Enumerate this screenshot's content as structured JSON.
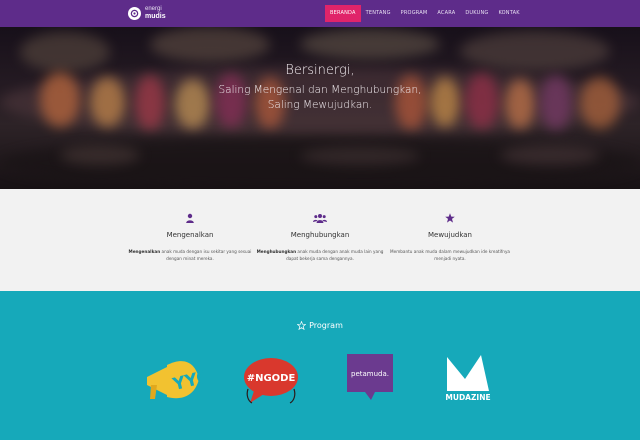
{
  "brand": {
    "top": "energi",
    "bottom": "mudis"
  },
  "nav": [
    {
      "label": "BERANDA",
      "active": true
    },
    {
      "label": "TENTANG",
      "active": false
    },
    {
      "label": "PROGRAM",
      "active": false
    },
    {
      "label": "ACARA",
      "active": false
    },
    {
      "label": "DUKUNG",
      "active": false
    },
    {
      "label": "KONTAK",
      "active": false
    }
  ],
  "hero": {
    "title": "Bersinergi,",
    "line1": "Saling Mengenal dan Menghubungkan,",
    "line2": "Saling Mewujudkan."
  },
  "features": [
    {
      "icon": "user-icon",
      "title": "Mengenalkan",
      "bold": "Mengenalkan",
      "desc": " anak muda dengan isu sekitar yang sesuai dengan minat mereka."
    },
    {
      "icon": "users-icon",
      "title": "Menghubungkan",
      "bold": "Menghubungkan",
      "desc": " anak muda dengan anak muda lain yang dapat bekerja sama dengannya."
    },
    {
      "icon": "star-icon",
      "title": "Mewujudkan",
      "bold": "",
      "desc": "Membantu anak muda dalam mewujudkan ide kreatifnya menjadi nyata."
    }
  ],
  "program": {
    "heading": "Program",
    "logos": [
      {
        "name": "yyc-logo",
        "text": "YYC"
      },
      {
        "name": "ngode-logo",
        "text": "#NGODE"
      },
      {
        "name": "petamuda-logo",
        "text": "petamuda."
      },
      {
        "name": "mudazine-logo",
        "text": "MUDAZINE"
      }
    ]
  },
  "colors": {
    "navbar": "#5e2c8a",
    "nav_active": "#e0246a",
    "features_bg": "#f2f2f2",
    "program_bg": "#16a9ba",
    "icon_purple": "#5e2c8a"
  }
}
